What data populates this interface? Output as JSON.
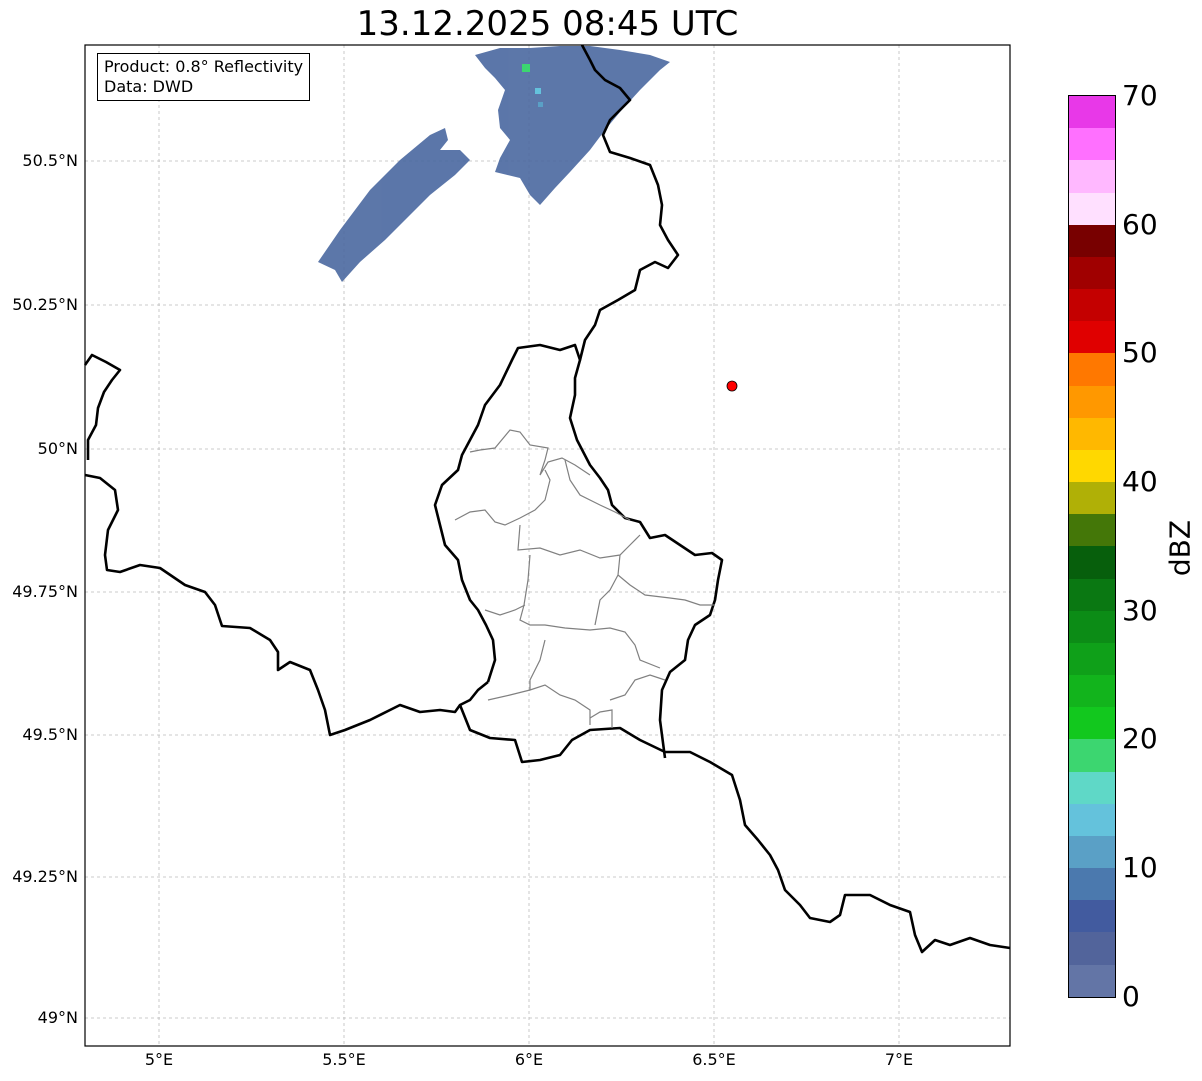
{
  "title": "13.12.2025 08:45 UTC",
  "info": {
    "product": "Product: 0.8° Reflectivity",
    "data": "Data: DWD"
  },
  "axes": {
    "lon_ticks": [
      "5°E",
      "5.5°E",
      "6°E",
      "6.5°E",
      "7°E"
    ],
    "lat_ticks": [
      "50.5°N",
      "50.25°N",
      "50°N",
      "49.75°N",
      "49.5°N",
      "49.25°N",
      "49°N"
    ]
  },
  "colorbar": {
    "unit": "dBZ",
    "ticks": [
      "0",
      "10",
      "20",
      "30",
      "40",
      "50",
      "60",
      "70"
    ],
    "colors": [
      "#6375a6",
      "#52649b",
      "#425b9f",
      "#4b79ae",
      "#5aa0c6",
      "#64c2dc",
      "#5fd8c7",
      "#3cd670",
      "#12c81e",
      "#12b41c",
      "#0fa019",
      "#0c8c16",
      "#0a7812",
      "#075f0c",
      "#447708",
      "#b0b006",
      "#ffd800",
      "#ffb800",
      "#ff9800",
      "#ff7800",
      "#e00000",
      "#c40000",
      "#a00000",
      "#780000",
      "#ffe0ff",
      "#ffb8ff",
      "#ff70ff",
      "#e838e8"
    ]
  },
  "marker": {
    "color": "#ff0000"
  },
  "colors": {
    "border": "#000000",
    "cantons": "#808080",
    "grid": "#bbbbbb",
    "echo": "#4a68a0"
  }
}
